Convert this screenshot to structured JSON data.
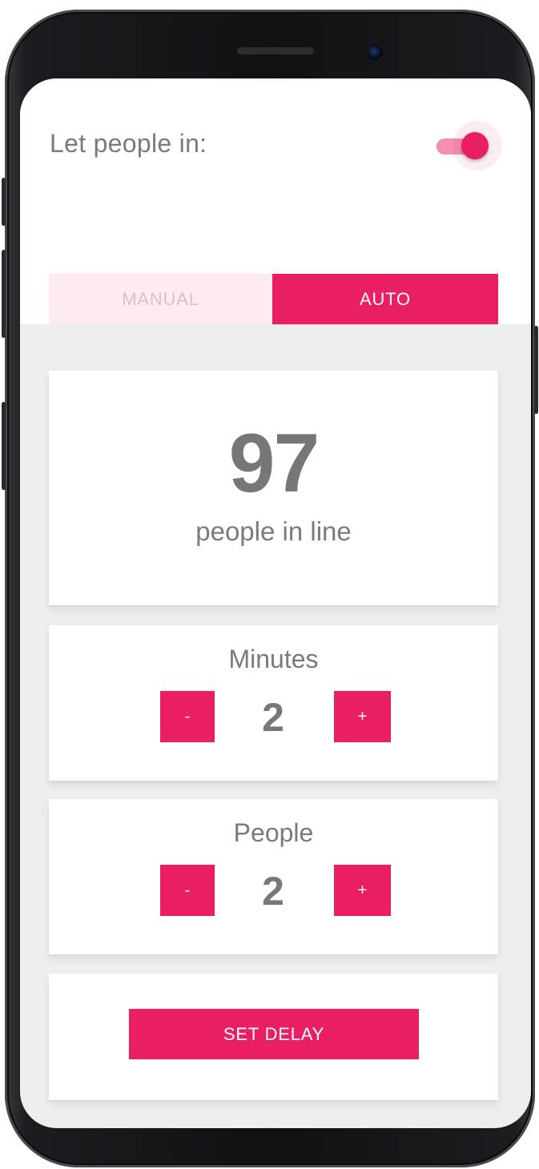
{
  "header": {
    "let_in_label": "Let people in:",
    "let_in_enabled": true
  },
  "tabs": [
    {
      "label": "MANUAL",
      "active": false
    },
    {
      "label": "AUTO",
      "active": true
    }
  ],
  "queue": {
    "count": "97",
    "label": "people in line"
  },
  "minutes": {
    "title": "Minutes",
    "value": "2",
    "minus_label": "-",
    "plus_label": "+"
  },
  "people": {
    "title": "People",
    "value": "2",
    "minus_label": "-",
    "plus_label": "+"
  },
  "actions": {
    "set_delay_label": "SET DELAY"
  },
  "colors": {
    "accent": "#e91e63",
    "accent_light": "#fdebf1",
    "text_gray": "#777777",
    "background": "#eeeeee"
  }
}
